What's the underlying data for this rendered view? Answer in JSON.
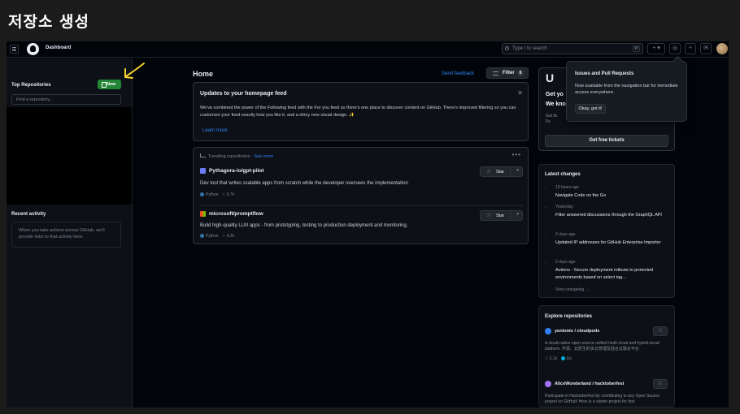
{
  "slide": {
    "title": "저장소 생성"
  },
  "header": {
    "dashboard_label": "Dashboard",
    "search_placeholder": "Type / to search",
    "search_shortcut": "⌘",
    "plus_label": "+ ▾"
  },
  "left": {
    "top_repos_title": "Top Repositories",
    "new_button": "New",
    "find_placeholder": "Find a repository...",
    "recent_title": "Recent activity",
    "recent_empty": "When you take actions across GitHub, we'll provide links to that activity here."
  },
  "main": {
    "home_title": "Home",
    "feedback_link": "Send feedback",
    "filter_label": "Filter",
    "filter_count": "8",
    "updates": {
      "title": "Updates to your homepage feed",
      "close": "✕",
      "body": "We've combined the power of the Following feed with the For you feed so there's one place to discover content on GitHub. There's improved filtering so you can customize your feed exactly how you like it, and a shiny new visual design. ✨",
      "learn_more": "Learn more"
    },
    "trending": {
      "header": "Trending repositories",
      "separator": " · ",
      "see_more": "See more",
      "dots": "•••",
      "repos": [
        {
          "name": "Pythagora-io/gpt-pilot",
          "description": "Dev tool that writes scalable apps from scratch while the developer oversees the implementation",
          "language": "Python",
          "stars": "9.7k",
          "star_label": "Star",
          "icon_color": "#6e7cf5"
        },
        {
          "name": "microsoft/promptflow",
          "description": "Build high-quality LLM apps - from prototyping, testing to production deployment and monitoring.",
          "language": "Python",
          "stars": "4.2k",
          "star_label": "Star",
          "icon_color": "#f25022"
        }
      ]
    }
  },
  "right": {
    "promo": {
      "logo": "U",
      "line1": "Get yo",
      "line2": "We kno",
      "line3": "Get tic\nFo",
      "tickets_button": "Get free tickets"
    },
    "tooltip": {
      "title": "Issues and Pull Requests",
      "body": "Now available from the navigation bar for immediate access everywhere.",
      "button": "Okay, got it!"
    },
    "changes": {
      "title": "Latest changes",
      "items": [
        {
          "time": "19 hours ago",
          "text": "Navigate Code on the Go"
        },
        {
          "time": "Yesterday",
          "text": "Filter answered discussions through the GraphQL API"
        },
        {
          "time": "2 days ago",
          "text": "Updated IP addresses for GitHub Enterprise Importer"
        },
        {
          "time": "2 days ago",
          "text": "Actions - Secure deployment rollouts to protected environments based on select tag..."
        }
      ],
      "view_more": "View changelog →"
    },
    "explore": {
      "title": "Explore repositories",
      "repos": [
        {
          "name": "yunionio / cloudpods",
          "description": "A cloud-native open-source unified multi-cloud and hybrid-cloud platform. 开源、云原生的多云管理及混合云融合平台",
          "stars": "2.1k",
          "language": "Go",
          "avatar_color": "#2f81f7"
        },
        {
          "name": "AliceWonderland / hacktoberfest",
          "description": "Participate in Hacktoberfest by contributing to any Open Source project on GitHub! Here is a starter project for first",
          "avatar_color": "#a371f7"
        }
      ]
    }
  },
  "colors": {
    "accent_blue": "#2f81f7",
    "new_green": "#238636",
    "bg": "#010409",
    "annotation_yellow": "#f2d32a"
  }
}
